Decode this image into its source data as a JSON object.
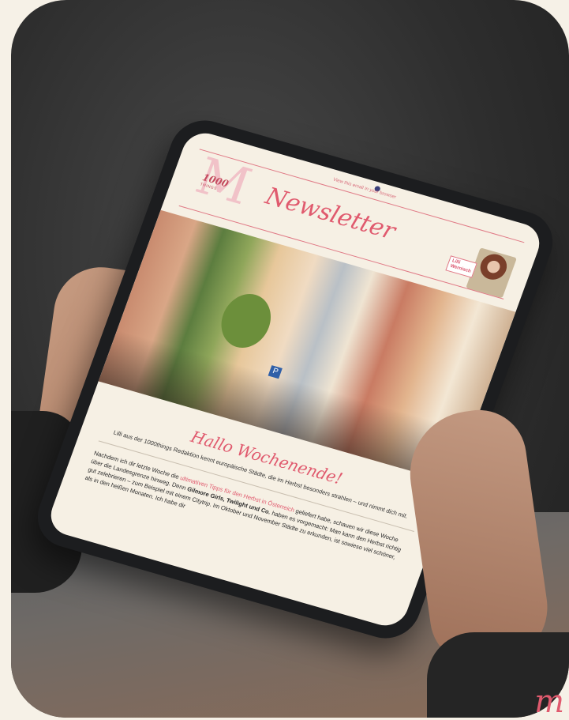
{
  "screen": {
    "browser_link": "View this email in your browser",
    "logo_number": "1000",
    "logo_sub": "THINGS",
    "title": "Newsletter",
    "author_name_line1": "Lilli",
    "author_name_line2": "Wernisch",
    "greeting": "Hallo Wochenende!",
    "lead": "Lilli aus der 1000things Redaktion kennt europäische Städte, die im Herbst besonders strahlen – und nimmt dich mit.",
    "body": {
      "p1_start": "Nachdem ich dir letzte Woche die ",
      "p1_link": "ultimativen Tipps für den Herbst in Österreich",
      "p1_end": " geliefert habe, schauen wir diese Woche über die Landesgrenze hinweg. Denn ",
      "bold": "Gilmore Girls, Twilight und Co.",
      "p1_rest": " haben es vorgemacht: Man kann den Herbst richtig gut zelebrieren – zum Beispiel mit einem Citytrip. Im Oktober und November Städte zu erkunden, ist sowieso viel schöner, als in den heißen Monaten. Ich habe dir"
    },
    "hero_sign": "P"
  },
  "corner_mark": "m",
  "colors": {
    "accent": "#e05a6e",
    "paper": "#f6f0e4",
    "background": "#f6f1e7"
  }
}
